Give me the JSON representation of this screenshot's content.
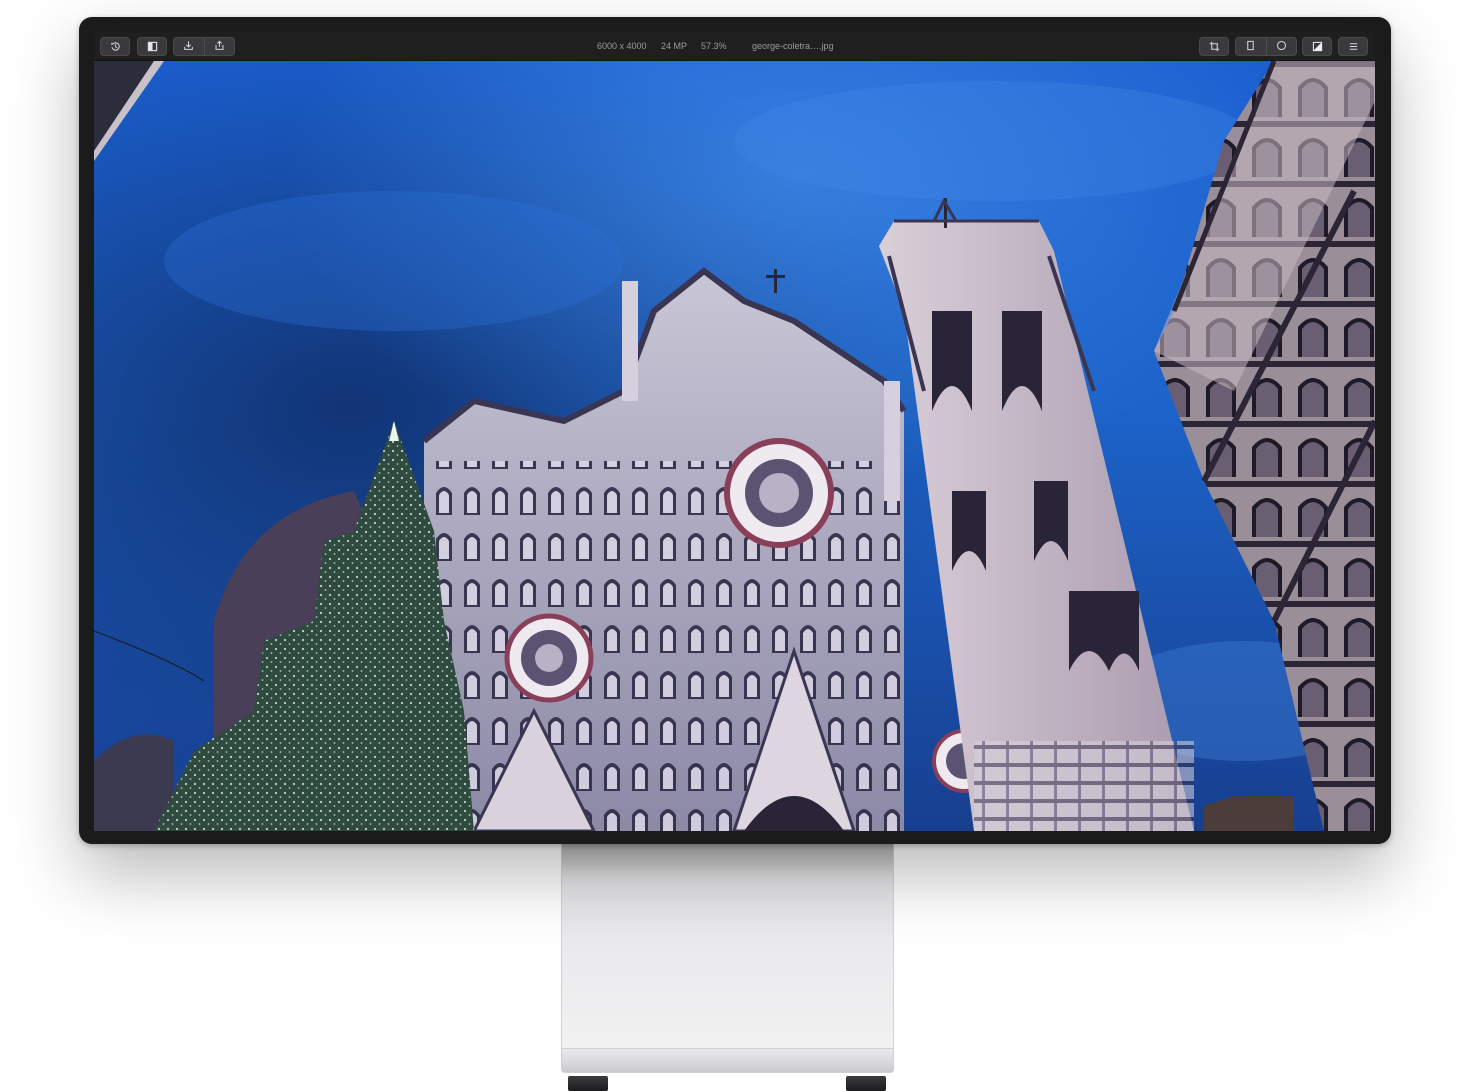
{
  "toolbar": {
    "left_buttons": [
      {
        "icon": "revert-icon"
      },
      {
        "icon": "sidebar-toggle-icon"
      },
      {
        "icon": "import-icon"
      },
      {
        "icon": "share-icon"
      }
    ],
    "info": {
      "dimensions": "6000 x 4000",
      "megapixels": "24 MP",
      "zoom": "57.3%",
      "filename": "george-coletra….jpg"
    },
    "right_buttons": [
      {
        "icon": "crop-icon"
      },
      {
        "icon": "portrait-rect-icon"
      },
      {
        "icon": "circle-icon"
      },
      {
        "icon": "compare-icon"
      },
      {
        "icon": "menu-icon"
      }
    ]
  },
  "photo": {
    "subject": "Florence Cathedral facade and bell tower at dusk with a lit Christmas tree",
    "colors": {
      "sky": "#1d63c9",
      "sky_dark": "#0f2f6e",
      "facade": "#c9c6d3",
      "facade_shadow": "#5b5a78",
      "tree": "#2f4b3f"
    }
  }
}
